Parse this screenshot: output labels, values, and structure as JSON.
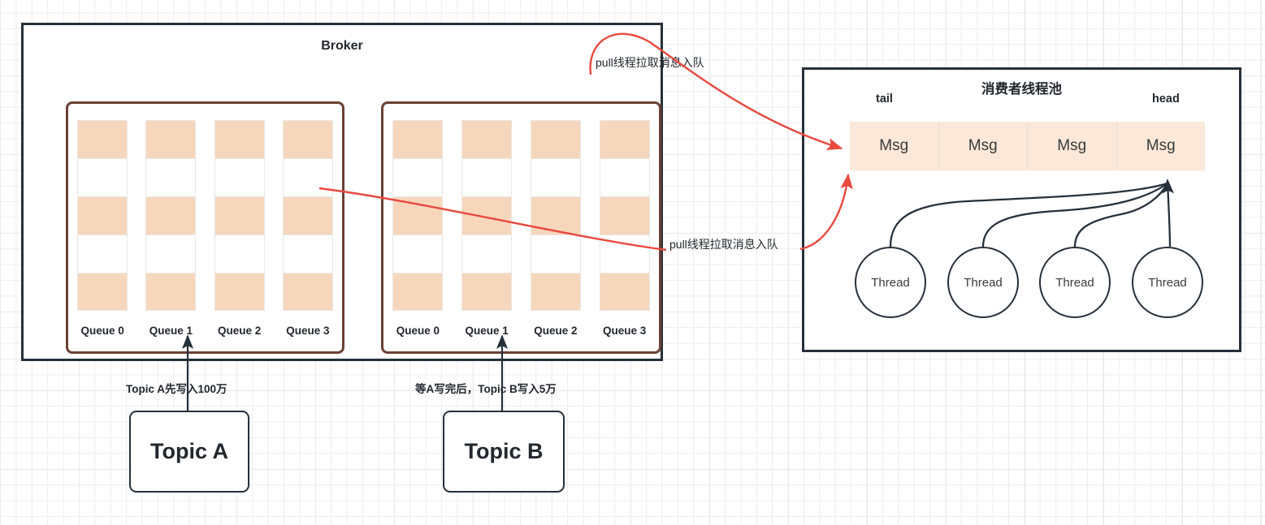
{
  "broker": {
    "title": "Broker",
    "queue_groups": [
      {
        "name": "topic-a-queues",
        "queues": [
          {
            "label": "Queue 0",
            "cells": [
              "filled",
              "empty",
              "filled",
              "empty",
              "filled"
            ]
          },
          {
            "label": "Queue 1",
            "cells": [
              "filled",
              "empty",
              "filled",
              "empty",
              "filled"
            ]
          },
          {
            "label": "Queue 2",
            "cells": [
              "filled",
              "empty",
              "filled",
              "empty",
              "filled"
            ]
          },
          {
            "label": "Queue 3",
            "cells": [
              "filled",
              "empty",
              "filled",
              "empty",
              "filled"
            ]
          }
        ]
      },
      {
        "name": "topic-b-queues",
        "queues": [
          {
            "label": "Queue 0",
            "cells": [
              "filled",
              "empty",
              "filled",
              "empty",
              "filled"
            ]
          },
          {
            "label": "Queue 1",
            "cells": [
              "filled",
              "empty",
              "filled",
              "empty",
              "filled"
            ]
          },
          {
            "label": "Queue 2",
            "cells": [
              "filled",
              "empty",
              "filled",
              "empty",
              "filled"
            ]
          },
          {
            "label": "Queue 3",
            "cells": [
              "filled",
              "empty",
              "filled",
              "empty",
              "filled"
            ]
          }
        ]
      }
    ]
  },
  "topics": [
    {
      "label": "Topic A",
      "edge_label": "Topic A先写入100万"
    },
    {
      "label": "Topic B",
      "edge_label": "等A写完后，Topic B写入5万"
    }
  ],
  "pull_arrows": [
    {
      "label": "pull线程拉取消息入队"
    },
    {
      "label": "pull线程拉取消息入队"
    }
  ],
  "pool": {
    "title": "消费者线程池",
    "tail_label": "tail",
    "head_label": "head",
    "messages": [
      {
        "label": "Msg"
      },
      {
        "label": "Msg"
      },
      {
        "label": "Msg"
      },
      {
        "label": "Msg"
      }
    ],
    "threads": [
      {
        "label": "Thread"
      },
      {
        "label": "Thread"
      },
      {
        "label": "Thread"
      },
      {
        "label": "Thread"
      }
    ]
  },
  "colors": {
    "queue_cell_filled": "#f7d7bb",
    "queue_cell_empty": "#ffffff",
    "msg_cell": "#fbe8d8",
    "box_border": "#26303b",
    "queue_group_border": "#6b4034",
    "arrow_red": "#e8493f",
    "arrow_dark": "#26303b"
  }
}
